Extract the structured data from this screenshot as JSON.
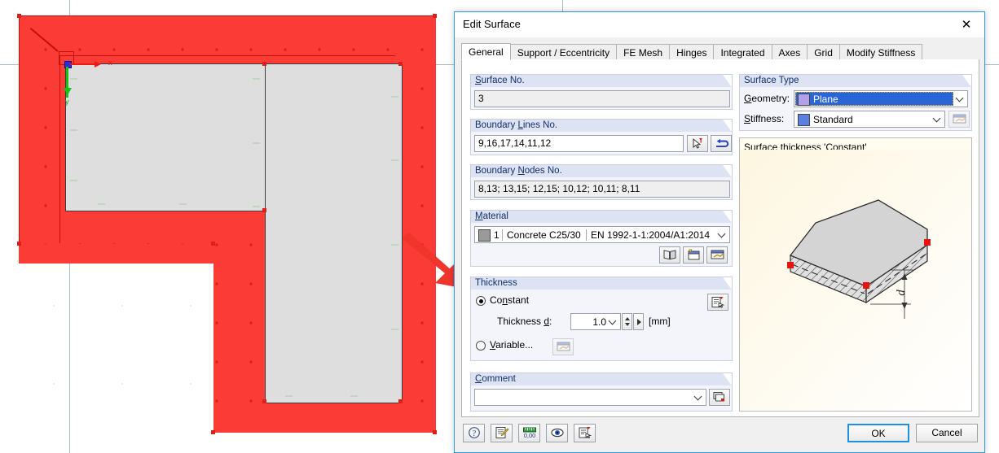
{
  "dialog": {
    "title": "Edit Surface",
    "close_icon": "close-icon",
    "tabs": [
      {
        "label": "General",
        "active": true
      },
      {
        "label": "Support / Eccentricity",
        "active": false
      },
      {
        "label": "FE Mesh",
        "active": false
      },
      {
        "label": "Hinges",
        "active": false
      },
      {
        "label": "Integrated",
        "active": false
      },
      {
        "label": "Axes",
        "active": false
      },
      {
        "label": "Grid",
        "active": false
      },
      {
        "label": "Modify Stiffness",
        "active": false
      }
    ]
  },
  "surface_no": {
    "group_label": "Surface No.",
    "accel": "S",
    "value": "3"
  },
  "boundary_lines": {
    "group_label": "Boundary Lines No.",
    "accel": "L",
    "value": "9,16,17,14,11,12",
    "pick_button": "pick-lines-button",
    "reverse_button": "reverse-orientation-button"
  },
  "boundary_nodes": {
    "group_label": "Boundary Nodes No.",
    "accel": "N",
    "value": "8,13; 13,15; 12,15; 10,12; 10,11; 8,11"
  },
  "material": {
    "group_label": "Material",
    "accel": "M",
    "number": "1",
    "name": "Concrete C25/30",
    "standard": "EN 1992-1-1:2004/A1:2014",
    "color": "#9a9a9a",
    "buttons": [
      {
        "name": "material-library-button",
        "icon": "book-icon"
      },
      {
        "name": "new-material-button",
        "icon": "new-window-icon"
      },
      {
        "name": "edit-material-button",
        "icon": "edit-dialog-icon"
      }
    ]
  },
  "thickness": {
    "group_label": "Thickness",
    "constant_label": "Constant",
    "constant_accel": "n",
    "constant_selected": true,
    "thickness_label": "Thickness d:",
    "thickness_accel": "d",
    "value": "1.0",
    "unit": "[mm]",
    "variable_label": "Variable...",
    "variable_accel": "V",
    "variable_selected": false,
    "info_button": "thickness-info-button",
    "variable_button": "variable-thickness-button"
  },
  "comment": {
    "group_label": "Comment",
    "accel": "C",
    "value": "",
    "placeholder": "",
    "button": "comment-list-button"
  },
  "surface_type": {
    "group_label": "Surface Type",
    "geometry_label": "Geometry:",
    "geometry_accel": "G",
    "geometry_value": "Plane",
    "geometry_color": "#b3a0ea",
    "geometry_selected": true,
    "stiffness_label": "Stiffness:",
    "stiffness_accel": "S",
    "stiffness_value": "Standard",
    "stiffness_color": "#5b7fe0",
    "stiffness_edit_button": "edit-stiffness-button"
  },
  "preview": {
    "header": "Surface thickness 'Constant'",
    "dimension_label": "d",
    "background": "#fffdf0",
    "slab_top_color": "#d4d4d4"
  },
  "footer": {
    "icon_buttons": [
      {
        "name": "help-button",
        "icon": "question-icon"
      },
      {
        "name": "notes-button",
        "icon": "pencil-note-icon"
      },
      {
        "name": "units-button",
        "icon": "ruler-000-icon"
      },
      {
        "name": "visibility-button",
        "icon": "eye-icon"
      },
      {
        "name": "info-button",
        "icon": "info-pick-icon"
      }
    ],
    "ok_label": "OK",
    "cancel_label": "Cancel"
  },
  "cad": {
    "selection_color": "#fb3b36",
    "surface_fill_color": "#dedede",
    "axis_x_label": "x",
    "axis_y_label": "y",
    "annotation_arrow": "red-callout-arrow"
  }
}
